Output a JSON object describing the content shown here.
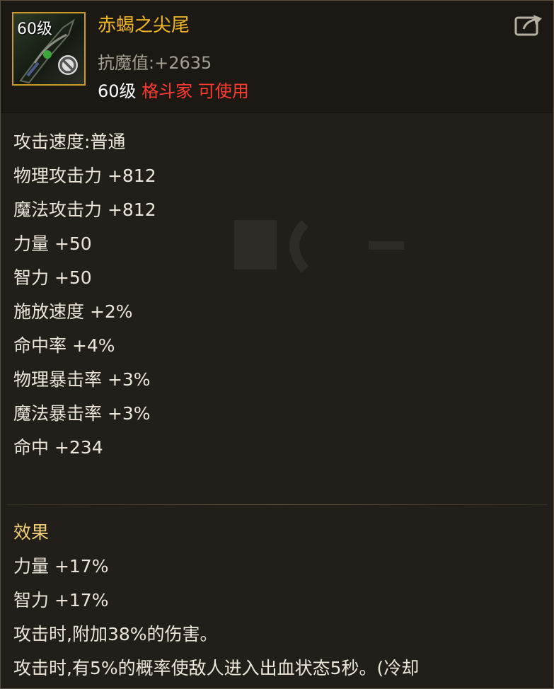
{
  "item": {
    "level_tag": "60级",
    "name": "赤蝎之尖尾",
    "anti_magic_label": "抗魔值:",
    "anti_magic_value": "+2635",
    "requirement": {
      "level": "60级",
      "class_name": "格斗家",
      "usable": "可使用"
    }
  },
  "stats": [
    "攻击速度:普通",
    "物理攻击力 +812",
    "魔法攻击力 +812",
    "力量 +50",
    "智力 +50",
    "施放速度 +2%",
    "命中率 +4%",
    "物理暴击率 +3%",
    "魔法暴击率 +3%",
    "命中 +234"
  ],
  "effect": {
    "title": "效果",
    "lines": [
      "力量 +17%",
      "智力 +17%",
      "攻击时,附加38%的伤害。",
      "攻击时,有5%的概率使敌人进入出血状态5秒。(冷却"
    ]
  },
  "colors": {
    "name": "#f0b722",
    "restriction": "#ff3b30",
    "effect_title": "#f3d27a",
    "frame": "#c99a2a"
  },
  "icons": {
    "share": "share-icon",
    "forbidden": "forbidden-icon",
    "item": "weapon-claw-icon"
  }
}
